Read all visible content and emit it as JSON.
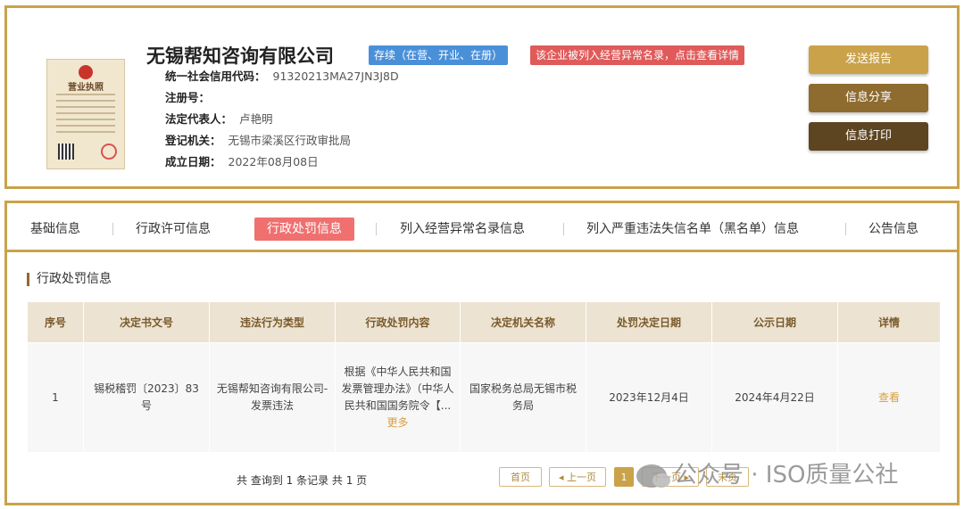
{
  "header": {
    "license_image": {
      "title": "营业执照"
    },
    "company_name": "无锡帮知咨询有限公司",
    "status_badge": "存续（在营、开业、在册）",
    "abnormal_notice": "该企业被列入经营异常名录，点击查看详情",
    "fields": [
      {
        "label": "统一社会信用代码：",
        "value": "91320213MA27JN3J8D"
      },
      {
        "label": "注册号：",
        "value": ""
      },
      {
        "label": "法定代表人：",
        "value": "卢艳明"
      },
      {
        "label": "登记机关：",
        "value": "无锡市梁溪区行政审批局"
      },
      {
        "label": "成立日期：",
        "value": "2022年08月08日"
      }
    ],
    "buttons": {
      "send": "发送报告",
      "share": "信息分享",
      "print": "信息打印"
    }
  },
  "tabs": [
    {
      "label": "基础信息"
    },
    {
      "label": "行政许可信息"
    },
    {
      "label": "行政处罚信息",
      "active": true
    },
    {
      "label": "列入经营异常名录信息"
    },
    {
      "label": "列入严重违法失信名单（黑名单）信息"
    },
    {
      "label": "公告信息"
    }
  ],
  "section_title": "行政处罚信息",
  "table": {
    "headers": [
      "序号",
      "决定书文号",
      "违法行为类型",
      "行政处罚内容",
      "决定机关名称",
      "处罚决定日期",
      "公示日期",
      "详情"
    ],
    "rows": [
      {
        "no": "1",
        "doc_no": "锡税稽罚〔2023〕83号",
        "violation_type": "无锡帮知咨询有限公司-发票违法",
        "content": "根据《中华人民共和国发票管理办法》（中华人民共和国国务院令【...",
        "more": "更多",
        "authority": "国家税务总局无锡市税务局",
        "decision_date": "2023年12月4日",
        "publish_date": "2024年4月22日",
        "detail": "查看"
      }
    ]
  },
  "pagination": {
    "summary": "共 查询到 1 条记录 共 1 页",
    "first": "首页",
    "prev": "◂ 上一页",
    "current": "1",
    "next": "下一页 ▸",
    "last": "末页"
  },
  "watermark": "公众号 · ISO质量公社"
}
